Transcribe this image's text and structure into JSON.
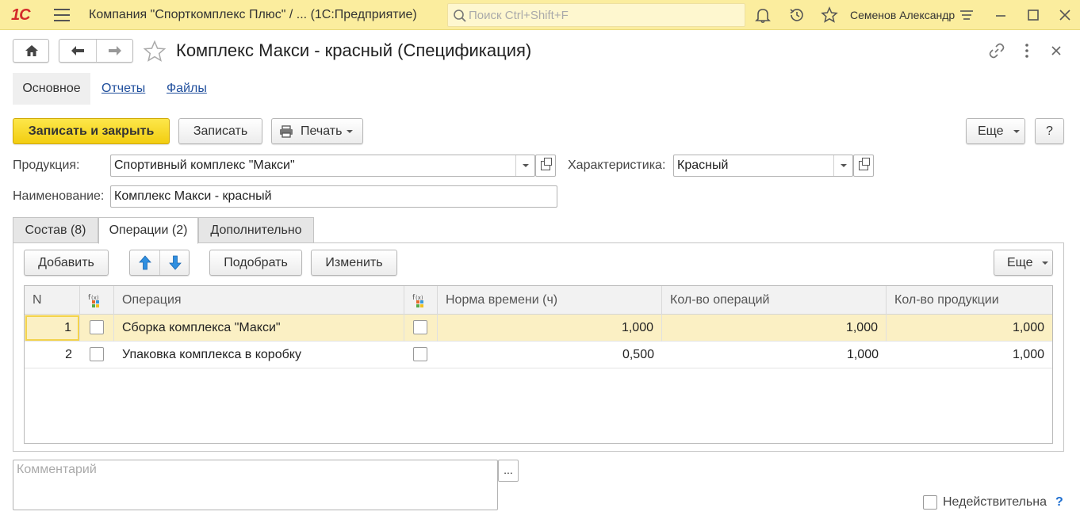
{
  "topbar": {
    "logo": "1С",
    "app_title": "Компания \"Спорткомплекс Плюс\" / ...  (1С:Предприятие)",
    "search_placeholder": "Поиск Ctrl+Shift+F",
    "user_name": "Семенов Александр",
    "icons": [
      "menu-icon",
      "bell-icon",
      "history-icon",
      "star-icon",
      "settings-icon",
      "minimize-icon",
      "maximize-icon",
      "close-icon"
    ]
  },
  "window": {
    "title": "Комплекс Макси - красный (Спецификация)",
    "icons": [
      "home-icon",
      "back-arrow-icon",
      "forward-arrow-icon",
      "favorite-star-icon",
      "link-icon",
      "more-icon",
      "close-icon"
    ]
  },
  "section_tabs": [
    {
      "label": "Основное"
    },
    {
      "label": "Отчеты"
    },
    {
      "label": "Файлы"
    }
  ],
  "commands": {
    "save_close": "Записать и закрыть",
    "save": "Записать",
    "print": "Печать",
    "more": "Еще",
    "help": "?"
  },
  "fields": {
    "product_label": "Продукция:",
    "product_value": "Спортивный комплекс \"Макси\"",
    "characteristic_label": "Характеристика:",
    "characteristic_value": "Красный",
    "name_label": "Наименование:",
    "name_value": "Комплекс Макси - красный"
  },
  "panel_tabs": [
    {
      "label": "Состав (8)"
    },
    {
      "label": "Операции (2)"
    },
    {
      "label": "Дополнительно"
    }
  ],
  "table_commands": {
    "add": "Добавить",
    "pick": "Подобрать",
    "change": "Изменить",
    "more": "Еще"
  },
  "table": {
    "headers": {
      "n": "N",
      "operation": "Операция",
      "time_norm": "Норма времени (ч)",
      "op_count": "Кол-во операций",
      "prod_count": "Кол-во продукции"
    },
    "rows": [
      {
        "n": "1",
        "operation": "Сборка комплекса \"Макси\"",
        "time_norm": "1,000",
        "op_count": "1,000",
        "prod_count": "1,000"
      },
      {
        "n": "2",
        "operation": "Упаковка комплекса в коробку",
        "time_norm": "0,500",
        "op_count": "1,000",
        "prod_count": "1,000"
      }
    ]
  },
  "footer": {
    "comment_placeholder": "Комментарий",
    "dots": "...",
    "invalid_label": "Недействительна",
    "help": "?"
  },
  "colors": {
    "topbar_bg": "#fbed9e",
    "primary_button": "#f2cd11",
    "link": "#1f4e9c",
    "selected_row": "#fbf0c4"
  }
}
